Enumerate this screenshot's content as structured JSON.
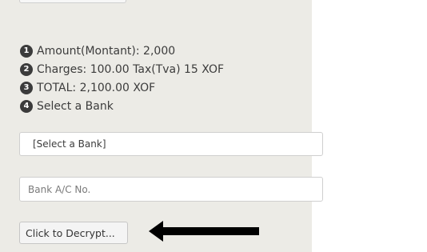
{
  "steps": [
    {
      "number": "1",
      "text": "Amount(Montant): 2,000"
    },
    {
      "number": "2",
      "text": "Charges: 100.00 Tax(Tva) 15 XOF"
    },
    {
      "number": "3",
      "text": "TOTAL: 2,100.00 XOF"
    },
    {
      "number": "4",
      "text": "Select a Bank"
    }
  ],
  "bank_select": {
    "selected": "[Select a Bank]"
  },
  "account_input": {
    "placeholder": "Bank A/C No.",
    "value": ""
  },
  "decrypt_button": {
    "label": "Click to Decrypt..."
  },
  "annotation": {
    "icon": "left-arrow-icon",
    "color": "#000000"
  }
}
